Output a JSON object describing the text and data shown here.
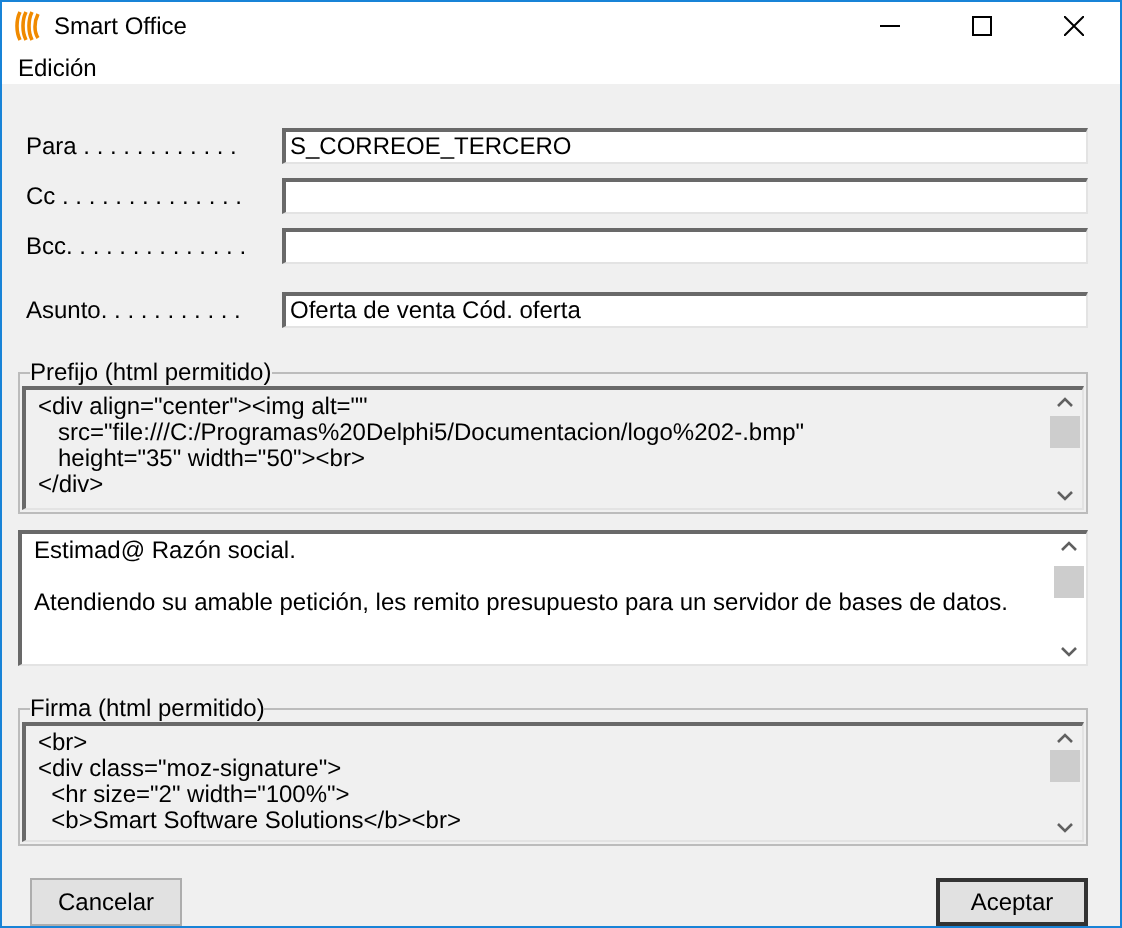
{
  "window": {
    "title": "Smart Office"
  },
  "menu": [
    "Edición"
  ],
  "fields": [
    {
      "label": "Para . . . . . . . . . . . .",
      "value": "S_CORREOE_TERCERO"
    },
    {
      "label": "Cc . . . . . . . . . . . . . ."
    },
    {
      "label": "Bcc. . . . . . . . . . . . . ."
    },
    {
      "label": "Asunto. . . . . . . . . . .",
      "value": "Oferta de venta Cód. oferta"
    }
  ],
  "prefix": {
    "title": "Prefijo (html permitido)",
    "lines": [
      "<div align=\"center\"><img alt=\"\"",
      "   src=\"file:///C:/Programas%20Delphi5/Documentacion/logo%202-.bmp\"",
      "   height=\"35\" width=\"50\"><br>",
      "</div>"
    ]
  },
  "body": {
    "paragraphs": [
      "Estimad@ Razón social.",
      "Atendiendo su amable petición, les remito presupuesto para un servidor de bases de datos."
    ]
  },
  "signature": {
    "title": "Firma (html permitido)",
    "lines": [
      "<br>",
      "<div class=\"moz-signature\">",
      "  <hr size=\"2\" width=\"100%\">",
      "  <b>Smart Software Solutions</b><br>"
    ]
  },
  "buttons": [
    "Cancelar",
    "Aceptar"
  ]
}
